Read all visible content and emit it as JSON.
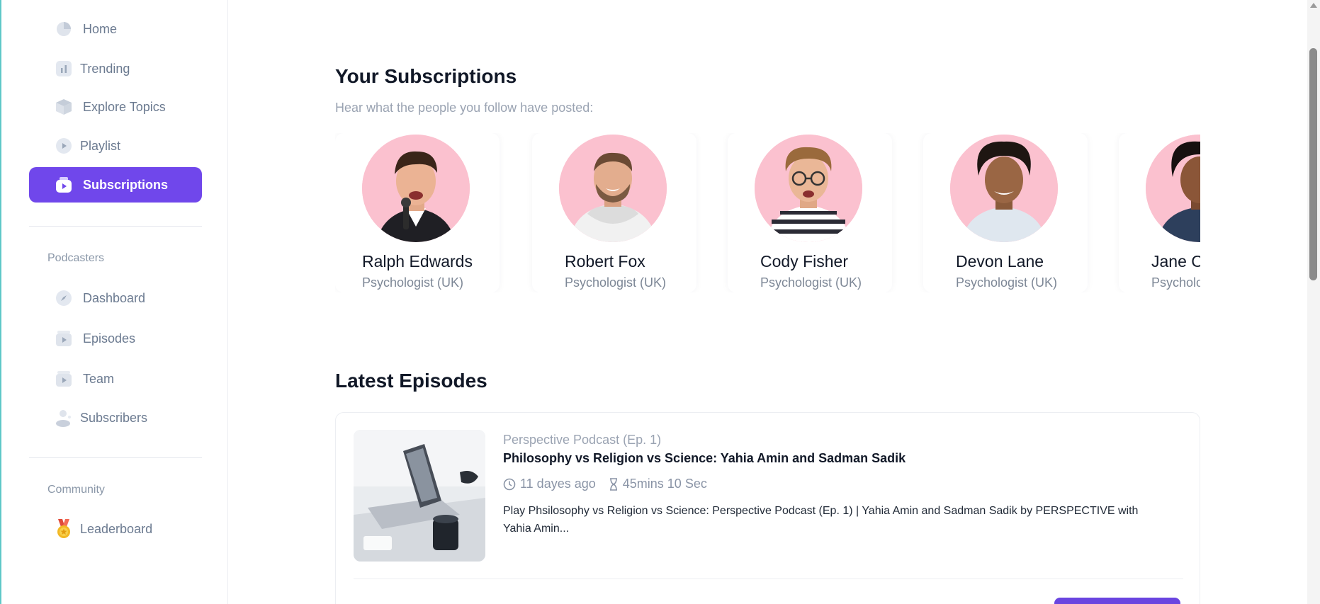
{
  "sidebar": {
    "main_items": [
      {
        "label": "Home",
        "icon": "pie-chart-icon"
      },
      {
        "label": "Trending",
        "icon": "bar-chart-icon"
      },
      {
        "label": "Explore Topics",
        "icon": "cube-icon"
      },
      {
        "label": "Playlist",
        "icon": "play-circle-icon"
      },
      {
        "label": "Subscriptions",
        "icon": "subscriptions-icon",
        "active": true
      }
    ],
    "podcasters_title": "Podcasters",
    "podcaster_items": [
      {
        "label": "Dashboard",
        "icon": "compass-icon"
      },
      {
        "label": "Episodes",
        "icon": "episodes-icon"
      },
      {
        "label": "Team",
        "icon": "team-icon"
      },
      {
        "label": "Subscribers",
        "icon": "user-icon"
      }
    ],
    "community_title": "Community",
    "community_items": [
      {
        "label": "Leaderboard",
        "icon": "medal-icon"
      }
    ]
  },
  "subscriptions": {
    "title": "Your Subscriptions",
    "subtitle": "Hear what the people you follow have posted:",
    "people": [
      {
        "name": "Ralph Edwards",
        "role": "Psychologist (UK)"
      },
      {
        "name": "Robert Fox",
        "role": "Psychologist (UK)"
      },
      {
        "name": "Cody Fisher",
        "role": "Psychologist (UK)"
      },
      {
        "name": "Devon Lane",
        "role": "Psychologist (UK)"
      },
      {
        "name": "Jane Cooper",
        "role": "Psychologist (UK)"
      }
    ]
  },
  "latest": {
    "title": "Latest Episodes",
    "episode": {
      "series": "Perspective Podcast (Ep. 1)",
      "title": "Philosophy vs Religion vs Science: Yahia Amin and Sadman Sadik",
      "posted": "11 dayes ago",
      "duration": "45mins 10 Sec",
      "description": "Play Phsilosophy vs Religion vs Science: Perspective Podcast (Ep. 1) | Yahia Amin and Sadman Sadik by PERSPECTIVE with Yahia Amin..."
    }
  },
  "colors": {
    "accent": "#7047eb",
    "avatar_bg": "#fbc1cf",
    "muted_text": "#6b7a90"
  }
}
